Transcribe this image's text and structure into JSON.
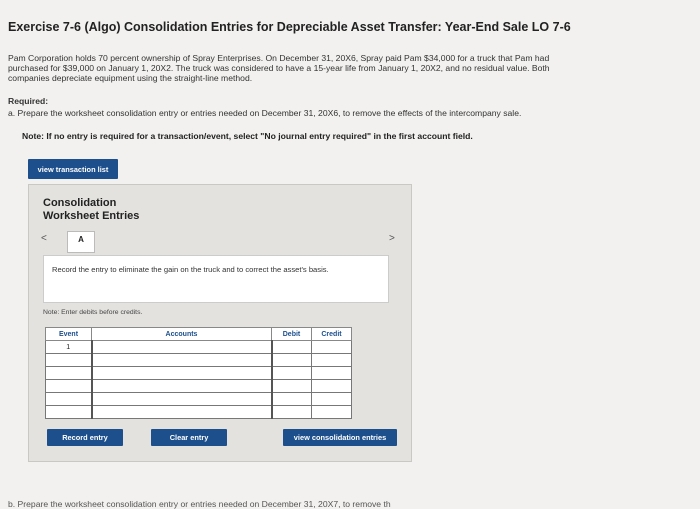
{
  "header": {
    "title": "Exercise 7-6 (Algo) Consolidation Entries for Depreciable Asset Transfer: Year-End Sale LO 7-6"
  },
  "problem": {
    "intro": "Pam Corporation holds 70 percent ownership of Spray Enterprises. On December 31, 20X6, Spray paid Pam $34,000 for a truck that Pam had purchased for $39,000 on January 1, 20X2. The truck was considered to have a 15-year life from January 1, 20X2, and no residual value. Both companies depreciate equipment using the straight-line method.",
    "required_label": "Required:",
    "part_a": "a. Prepare the worksheet consolidation entry or entries needed on December 31, 20X6, to remove the effects of the intercompany sale.",
    "note": "Note: If no entry is required for a transaction/event, select \"No journal entry required\" in the first account field."
  },
  "toolbar": {
    "view_transaction_list": "view transaction list"
  },
  "panel": {
    "title_line1": "Consolidation",
    "title_line2": "Worksheet Entries",
    "nav_prev": "<",
    "tab_label": "A",
    "nav_next": ">",
    "instruction": "Record the entry to eliminate the gain on the truck and to correct the asset's basis.",
    "note_credits": "Note: Enter debits before credits.",
    "table": {
      "headers": {
        "event": "Event",
        "accounts": "Accounts",
        "debit": "Debit",
        "credit": "Credit"
      },
      "rows": [
        {
          "event": "1",
          "account": "",
          "debit": "",
          "credit": ""
        },
        {
          "event": "",
          "account": "",
          "debit": "",
          "credit": ""
        },
        {
          "event": "",
          "account": "",
          "debit": "",
          "credit": ""
        },
        {
          "event": "",
          "account": "",
          "debit": "",
          "credit": ""
        },
        {
          "event": "",
          "account": "",
          "debit": "",
          "credit": ""
        },
        {
          "event": "",
          "account": "",
          "debit": "",
          "credit": ""
        }
      ]
    },
    "record_entry": "Record entry",
    "clear_entry": "Clear entry",
    "view_consolidation_entries": "view consolidation entries"
  },
  "footer": {
    "cut_text": "b. Prepare the worksheet consolidation entry or entries needed on December 31, 20X7, to remove th"
  },
  "colors": {
    "accent": "#1c4f8c",
    "background": "#f2f1ef",
    "panel": "#e3e2df"
  }
}
